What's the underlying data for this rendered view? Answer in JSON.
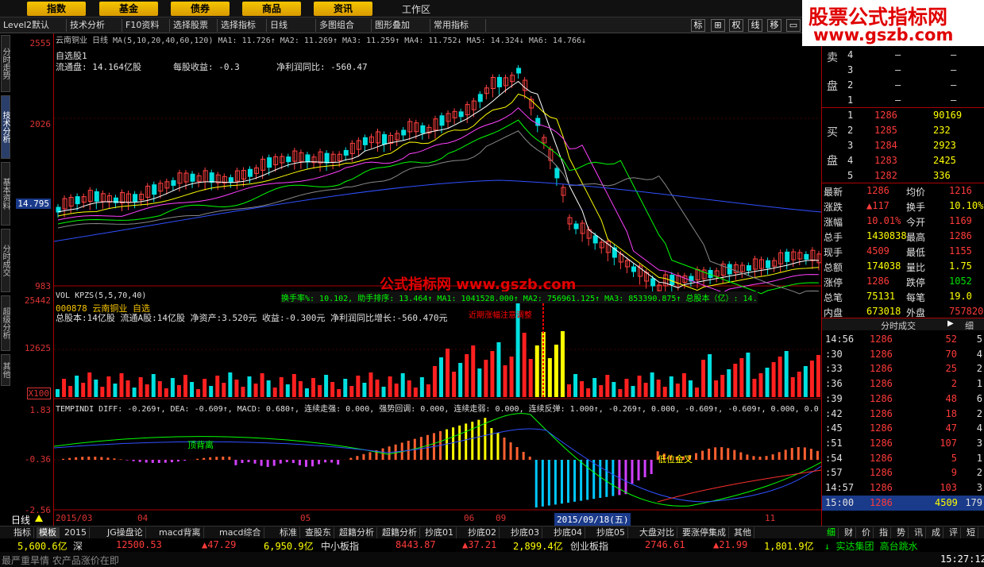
{
  "topbar": {
    "buttons": [
      "指数",
      "基金",
      "债券",
      "商品",
      "资讯"
    ],
    "workspace": "工作区"
  },
  "toolbar": {
    "items": [
      "Level2默认",
      "技术分析",
      "F10资料",
      "选择股票",
      "选择指标",
      "日线",
      "多图组合",
      "图形叠加",
      "常用指标"
    ],
    "icons": [
      "标",
      "权",
      "线",
      "移"
    ]
  },
  "brand": {
    "line1": "股票公式指标网",
    "line2": "www.gszb.com"
  },
  "left_tabs": [
    "分时走势",
    "技术分析",
    "基本资料",
    "分时成交",
    "超级分析",
    "其他"
  ],
  "price_axis": [
    "2555",
    "2026",
    "14.795",
    "983"
  ],
  "vol_axis": [
    "25442",
    "12625",
    "X100"
  ],
  "macd_axis": [
    "1.83",
    "-0.36",
    "-2.56"
  ],
  "main_chart": {
    "header": "云南铜业 日线 MA(5,10,20,40,60,120) MA1: 11.726↑ MA2: 11.269↑ MA3: 11.259↑ MA4: 11.752↓ MA5: 14.324↓ MA6: 14.766↓",
    "info1": "自选股1",
    "info2": "流通盘: 14.164亿股",
    "info3": "每股收益: -0.3",
    "info4": "净利润同比: -560.47",
    "watermark": "公式指标网 www.gszb.com"
  },
  "vol_chart": {
    "header": "VOL KPZS(5,5,70,40)",
    "header2": "换手率%: 10.102, 助手排序: 13.464↑ MA1: 1041528.000↑ MA2: 756961.125↑ MA3: 853390.875↑ 总股本（亿）: 14.",
    "info1": "000878 云南铜业 自选",
    "info2": "总股本:14亿股 流通A股:14亿股 净资产:3.520元 收益:-0.300元 净利润同比增长:-560.470元",
    "note": "近期涨幅注意调整"
  },
  "macd_chart": {
    "header": "TEMPINDI DIFF: -0.269↑, DEA: -0.609↑, MACD: 0.680↑, 连续走强: 0.000, 强势回调: 0.000, 连续走弱: 0.000, 连续反弹: 1.000↑, -0.269↑, 0.000, -0.609↑, -0.609↑, 0.000, 0.0",
    "label1": "顶背离",
    "label2": "低位金叉"
  },
  "x_axis": {
    "labels": [
      "2015/03",
      "04",
      "05",
      "06",
      "09",
      "11"
    ],
    "selected_date": "2015/09/18(五)",
    "period": "日线"
  },
  "order_book": {
    "sell": [
      {
        "lvl": "4",
        "p": "–",
        "v": "–"
      },
      {
        "lvl": "3",
        "p": "–",
        "v": "–"
      },
      {
        "lvl": "2",
        "p": "–",
        "v": "–"
      },
      {
        "lvl": "1",
        "p": "–",
        "v": "–"
      }
    ],
    "buy": [
      {
        "lvl": "1",
        "p": "1286",
        "v": "90169"
      },
      {
        "lvl": "2",
        "p": "1285",
        "v": "232"
      },
      {
        "lvl": "3",
        "p": "1284",
        "v": "2923"
      },
      {
        "lvl": "4",
        "p": "1283",
        "v": "2425"
      },
      {
        "lvl": "5",
        "p": "1282",
        "v": "336"
      }
    ],
    "sell_label": [
      "卖",
      "盘"
    ],
    "buy_label": [
      "买",
      "盘"
    ]
  },
  "quote": [
    {
      "k1": "最新",
      "v1": "1286",
      "k2": "均价",
      "v2": "1216"
    },
    {
      "k1": "涨跌",
      "v1": "▲117",
      "k2": "换手",
      "v2": "10.10%"
    },
    {
      "k1": "涨幅",
      "v1": "10.01%",
      "k2": "今开",
      "v2": "1169"
    },
    {
      "k1": "总手",
      "v1": "1430838",
      "k2": "最高",
      "v2": "1286"
    },
    {
      "k1": "现手",
      "v1": "4509",
      "k2": "最低",
      "v2": "1155"
    },
    {
      "k1": "总额",
      "v1": "174038",
      "k2": "量比",
      "v2": "1.75"
    },
    {
      "k1": "涨停",
      "v1": "1286",
      "k2": "跌停",
      "v2": "1052"
    },
    {
      "k1": "总笔",
      "v1": "75131",
      "k2": "每笔",
      "v2": "19.0"
    },
    {
      "k1": "内盘",
      "v1": "673018",
      "k2": "外盘",
      "v2": "757820"
    }
  ],
  "trades_header": "分时成交",
  "trades_tab": "细",
  "trades": [
    {
      "t": "14:56",
      "p": "1286",
      "v": "52",
      "n": "5"
    },
    {
      "t": ":30",
      "p": "1286",
      "v": "70",
      "n": "4"
    },
    {
      "t": ":33",
      "p": "1286",
      "v": "25",
      "n": "2"
    },
    {
      "t": ":36",
      "p": "1286",
      "v": "2",
      "n": "1"
    },
    {
      "t": ":39",
      "p": "1286",
      "v": "48",
      "n": "6"
    },
    {
      "t": ":42",
      "p": "1286",
      "v": "18",
      "n": "2"
    },
    {
      "t": ":45",
      "p": "1286",
      "v": "47",
      "n": "4"
    },
    {
      "t": ":51",
      "p": "1286",
      "v": "107",
      "n": "3"
    },
    {
      "t": ":54",
      "p": "1286",
      "v": "5",
      "n": "1"
    },
    {
      "t": ":57",
      "p": "1286",
      "v": "9",
      "n": "2"
    },
    {
      "t": "14:57",
      "p": "1286",
      "v": "103",
      "n": "3"
    },
    {
      "t": "15:00",
      "p": "1286",
      "v": "4509",
      "n": "179"
    }
  ],
  "bottom_tabs": [
    "指标",
    "模板",
    "2015",
    "JG操盘论",
    "macd背离",
    "macd综合",
    "标准",
    "查股东",
    "超籍分析",
    "超籍分析",
    "抄底01",
    "抄底02",
    "抄底03",
    "抄底04",
    "抄底05",
    "大盘对比",
    "要涨停集成",
    "其他"
  ],
  "right_tabs": [
    "细",
    "财",
    "价",
    "指",
    "势",
    "讯",
    "成",
    "评",
    "短"
  ],
  "ticker": {
    "a": "5,600.6亿",
    "a2": "深",
    "b": "12500.53",
    "c": "▲47.29",
    "d": "6,950.9亿",
    "e": "中小板指",
    "f": "8443.87",
    "g": "▲37.21",
    "h": "2,899.4亿",
    "i": "创业板指",
    "j": "2746.61",
    "k": "▲21.99",
    "l": "1,801.9亿",
    "m": "↓ 实达集团 高台跳水"
  },
  "status": {
    "text": "最严重旱情 农产品涨价在即",
    "time": "15:27:12"
  }
}
